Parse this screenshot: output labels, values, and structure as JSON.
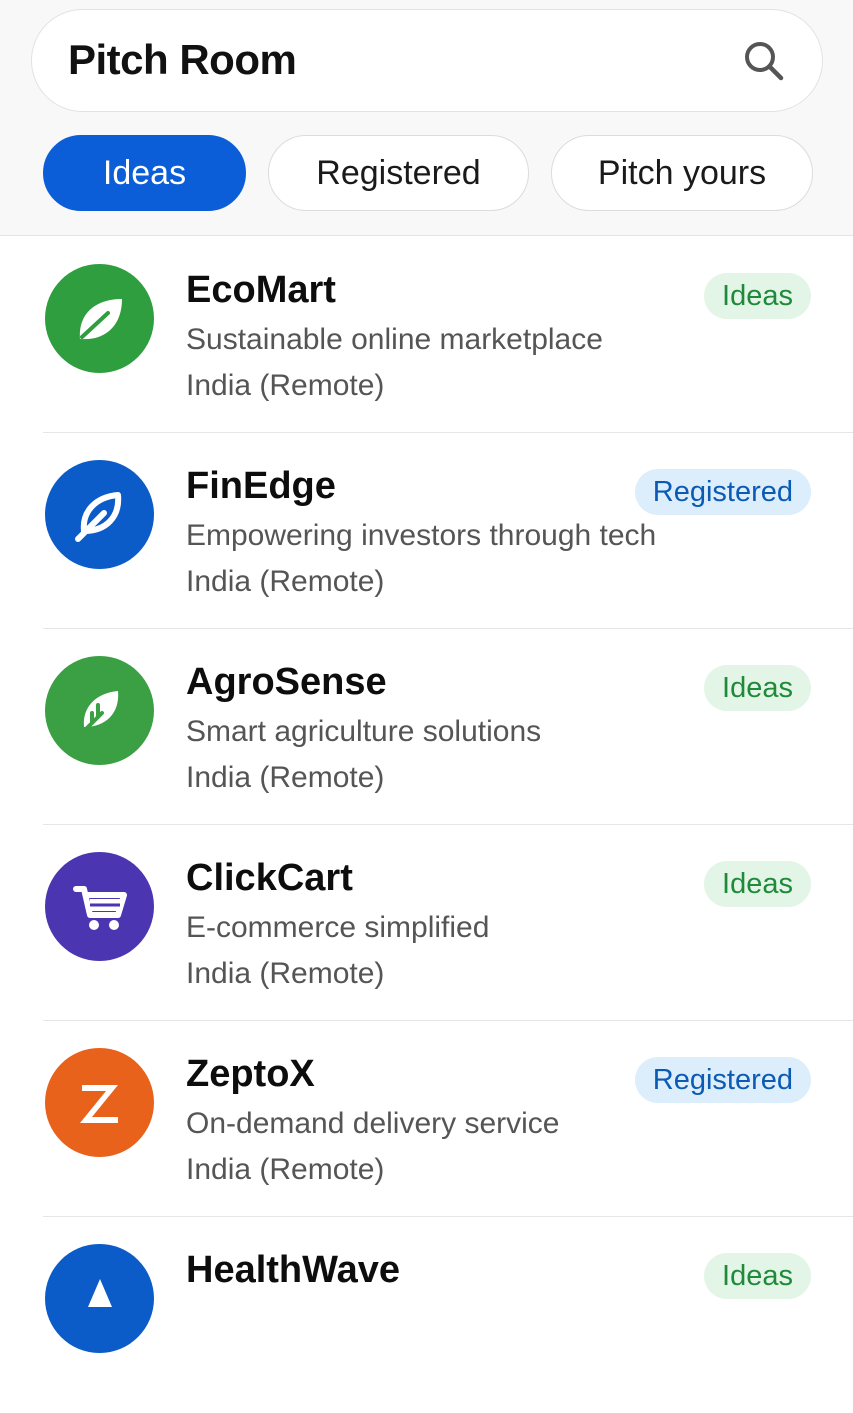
{
  "header": {
    "title": "Pitch Room",
    "search_icon": "search-icon"
  },
  "tabs": [
    {
      "label": "Ideas",
      "active": true
    },
    {
      "label": "Registered",
      "active": false
    },
    {
      "label": "Pitch yours",
      "active": false
    }
  ],
  "colors": {
    "accent": "#0b5ed7",
    "ideas_badge_bg": "#e3f5e6",
    "ideas_badge_text": "#1e8a3a",
    "registered_badge_bg": "#dcedfb",
    "registered_badge_text": "#0b5bb5"
  },
  "startups": [
    {
      "name": "EcoMart",
      "description": "Sustainable online marketplace",
      "location": "India  (Remote)",
      "status": "Ideas",
      "icon": "leaf-icon",
      "icon_color": "#2e9e3f"
    },
    {
      "name": "FinEdge",
      "description": "Empowering investors through tech",
      "location": "India  (Remote)",
      "status": "Registered",
      "icon": "leaf-outline-icon",
      "icon_color": "#0b5cc8"
    },
    {
      "name": "AgroSense",
      "description": "Smart agriculture solutions",
      "location": "India  (Remote)",
      "status": "Ideas",
      "icon": "feather-leaf-icon",
      "icon_color": "#3aa043"
    },
    {
      "name": "ClickCart",
      "description": "E-commerce simplified",
      "location": "India  (Remote)",
      "status": "Ideas",
      "icon": "shopping-cart-icon",
      "icon_color": "#4b35b0"
    },
    {
      "name": "ZeptoX",
      "description": "On-demand delivery service",
      "location": "India  (Remote)",
      "status": "Registered",
      "icon": "z-letter-icon",
      "icon_color": "#e8621c"
    },
    {
      "name": "HealthWave",
      "description": "",
      "location": "",
      "status": "Ideas",
      "icon": "health-icon",
      "icon_color": "#0b5cc8"
    }
  ]
}
